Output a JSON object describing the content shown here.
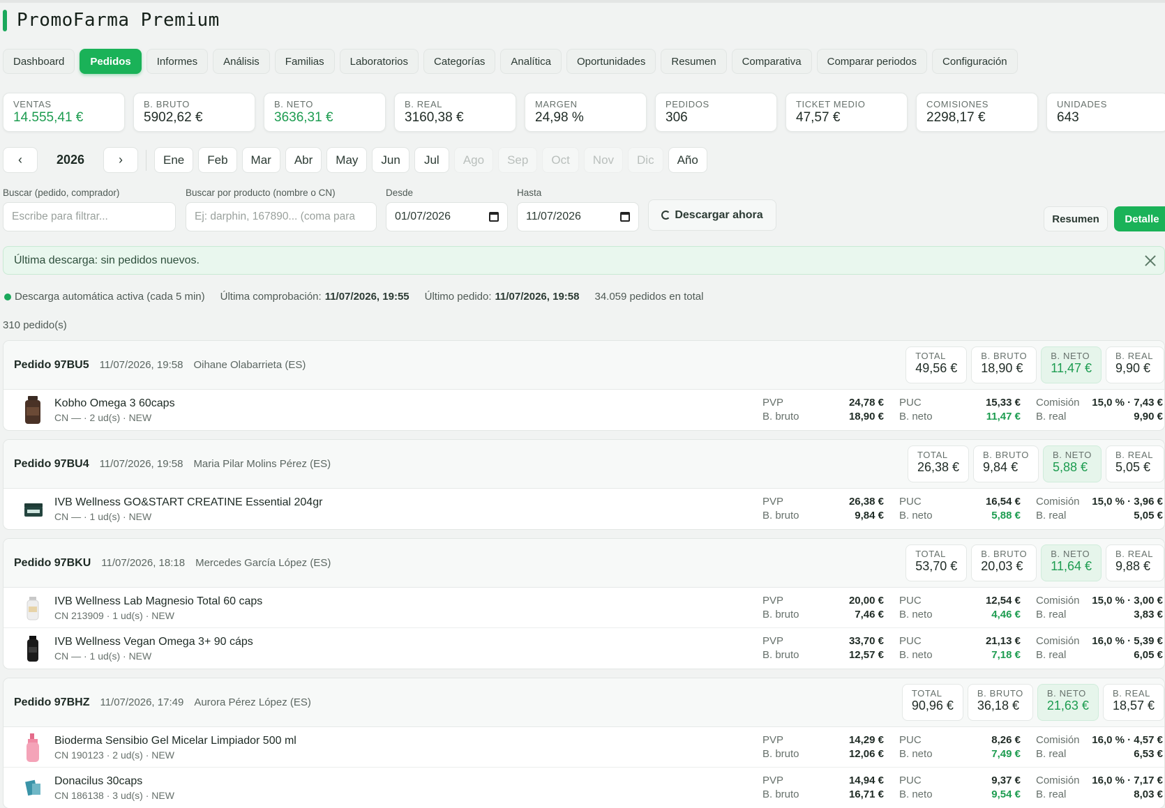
{
  "app": {
    "title": "PromoFarma Premium",
    "accent": "#1ab258"
  },
  "tabs": [
    "Dashboard",
    "Pedidos",
    "Informes",
    "Análisis",
    "Familias",
    "Laboratorios",
    "Categorías",
    "Analítica",
    "Oportunidades",
    "Resumen",
    "Comparativa",
    "Comparar periodos",
    "Configuración"
  ],
  "active_tab": "Pedidos",
  "kpis": [
    {
      "label": "VENTAS",
      "value": "14.555,41 €",
      "green": true
    },
    {
      "label": "B. BRUTO",
      "value": "5902,62 €",
      "green": false
    },
    {
      "label": "B. NETO",
      "value": "3636,31 €",
      "green": true
    },
    {
      "label": "B. REAL",
      "value": "3160,38 €",
      "green": false
    },
    {
      "label": "MARGEN",
      "value": "24,98 %",
      "green": false
    },
    {
      "label": "PEDIDOS",
      "value": "306",
      "green": false
    },
    {
      "label": "TICKET MEDIO",
      "value": "47,57 €",
      "green": false
    },
    {
      "label": "COMISIONES",
      "value": "2298,17 €",
      "green": false
    },
    {
      "label": "UNIDADES",
      "value": "643",
      "green": false
    }
  ],
  "months": {
    "prev": "‹",
    "next": "›",
    "year": "2026",
    "items": [
      {
        "label": "Ene",
        "enabled": true
      },
      {
        "label": "Feb",
        "enabled": true
      },
      {
        "label": "Mar",
        "enabled": true
      },
      {
        "label": "Abr",
        "enabled": true
      },
      {
        "label": "May",
        "enabled": true
      },
      {
        "label": "Jun",
        "enabled": true
      },
      {
        "label": "Jul",
        "enabled": true
      },
      {
        "label": "Ago",
        "enabled": false
      },
      {
        "label": "Sep",
        "enabled": false
      },
      {
        "label": "Oct",
        "enabled": false
      },
      {
        "label": "Nov",
        "enabled": false
      },
      {
        "label": "Dic",
        "enabled": false
      }
    ],
    "year_btn": "Año"
  },
  "filters": {
    "search_label": "Buscar (pedido, comprador)",
    "search_placeholder": "Escribe para filtrar...",
    "product_label": "Buscar por producto (nombre o CN)",
    "product_placeholder": "Ej: darphin, 167890... (coma para",
    "from_label": "Desde",
    "from_value": "01/07/2026",
    "to_label": "Hasta",
    "to_value": "11/07/2026",
    "download": "Descargar ahora",
    "view_summary": "Resumen",
    "view_detail": "Detalle"
  },
  "alert": "Última descarga: sin pedidos nuevos.",
  "status": {
    "auto": "Descarga automática activa (cada 5 min)",
    "check_label": "Última comprobación:",
    "check_value": "11/07/2026, 19:55",
    "last_label": "Último pedido:",
    "last_value": "11/07/2026, 19:58",
    "total": "34.059 pedidos en total"
  },
  "count": "310 pedido(s)",
  "labels": {
    "total": "TOTAL",
    "bruto": "B. BRUTO",
    "neto": "B. NETO",
    "real": "B. REAL",
    "pvp": "PVP",
    "b_bruto": "B. bruto",
    "puc": "PUC",
    "b_neto": "B. neto",
    "comision": "Comisión",
    "b_real": "B. real"
  },
  "orders": [
    {
      "id": "Pedido 97BU5",
      "date": "11/07/2026, 19:58",
      "buyer": "Oihane Olabarrieta (ES)",
      "total": "49,56 €",
      "bruto": "18,90 €",
      "neto": "11,47 €",
      "real": "9,90 €",
      "items": [
        {
          "name": "Kobho Omega 3 60caps",
          "meta": "CN — · 2 ud(s) · NEW",
          "thumb": "bottle-dark",
          "pvp": "24,78 €",
          "bbruto": "18,90 €",
          "puc": "15,33 €",
          "bneto": "11,47 €",
          "comision": "15,0 % · 7,43 €",
          "breal": "9,90 €"
        }
      ]
    },
    {
      "id": "Pedido 97BU4",
      "date": "11/07/2026, 19:58",
      "buyer": "Maria Pilar Molins Pérez (ES)",
      "total": "26,38 €",
      "bruto": "9,84 €",
      "neto": "5,88 €",
      "real": "5,05 €",
      "items": [
        {
          "name": "IVB Wellness GO&START CREATINE Essential 204gr",
          "meta": "CN — · 1 ud(s) · NEW",
          "thumb": "tub-dark",
          "pvp": "26,38 €",
          "bbruto": "9,84 €",
          "puc": "16,54 €",
          "bneto": "5,88 €",
          "comision": "15,0 % · 3,96 €",
          "breal": "5,05 €"
        }
      ]
    },
    {
      "id": "Pedido 97BKU",
      "date": "11/07/2026, 18:18",
      "buyer": "Mercedes García López (ES)",
      "total": "53,70 €",
      "bruto": "20,03 €",
      "neto": "11,64 €",
      "real": "9,88 €",
      "items": [
        {
          "name": "IVB Wellness Lab Magnesio Total 60 caps",
          "meta": "CN 213909 · 1 ud(s) · NEW",
          "thumb": "bottle-white",
          "pvp": "20,00 €",
          "bbruto": "7,46 €",
          "puc": "12,54 €",
          "bneto": "4,46 €",
          "comision": "15,0 % · 3,00 €",
          "breal": "3,83 €"
        },
        {
          "name": "IVB Wellness Vegan Omega 3+ 90 cáps",
          "meta": "CN — · 1 ud(s) · NEW",
          "thumb": "bottle-black",
          "pvp": "33,70 €",
          "bbruto": "12,57 €",
          "puc": "21,13 €",
          "bneto": "7,18 €",
          "comision": "16,0 % · 5,39 €",
          "breal": "6,05 €"
        }
      ]
    },
    {
      "id": "Pedido 97BHZ",
      "date": "11/07/2026, 17:49",
      "buyer": "Aurora Pérez López (ES)",
      "total": "90,96 €",
      "bruto": "36,18 €",
      "neto": "21,63 €",
      "real": "18,57 €",
      "items": [
        {
          "name": "Bioderma Sensibio Gel Micelar Limpiador 500 ml",
          "meta": "CN 190123 · 2 ud(s) · NEW",
          "thumb": "bottle-pink",
          "pvp": "14,29 €",
          "bbruto": "12,06 €",
          "puc": "8,26 €",
          "bneto": "7,49 €",
          "comision": "16,0 % · 4,57 €",
          "breal": "6,53 €"
        },
        {
          "name": "Donacilus 30caps",
          "meta": "CN 186138 · 3 ud(s) · NEW",
          "thumb": "box-teal",
          "pvp": "14,94 €",
          "bbruto": "16,71 €",
          "puc": "9,37 €",
          "bneto": "9,54 €",
          "comision": "16,0 % · 7,17 €",
          "breal": "8,03 €"
        }
      ]
    }
  ]
}
